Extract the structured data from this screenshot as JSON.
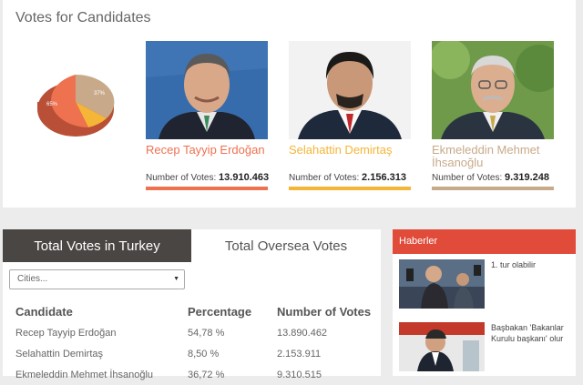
{
  "section_title": "Votes for Candidates",
  "pie": {
    "labels": [
      "65%",
      "37%"
    ],
    "colors": [
      "#ee7150",
      "#f5b536",
      "#c8aa8a"
    ]
  },
  "candidates": [
    {
      "name": "Recep Tayyip Erdoğan",
      "votes_label": "Number of Votes:",
      "votes": "13.910.463",
      "color": "#ee7150"
    },
    {
      "name": "Selahattin Demirtaş",
      "votes_label": "Number of Votes:",
      "votes": "2.156.313",
      "color": "#f5b536"
    },
    {
      "name": "Ekmeleddin Mehmet İhsanoğlu",
      "votes_label": "Number of Votes:",
      "votes": "9.319.248",
      "color": "#c8aa8a"
    }
  ],
  "tabs": {
    "turkey": "Total Votes in Turkey",
    "oversea": "Total Oversea Votes"
  },
  "cities_select": {
    "value": "Cities..."
  },
  "table": {
    "headers": [
      "Candidate",
      "Percentage",
      "Number of Votes"
    ],
    "rows": [
      [
        "Recep Tayyip Erdoğan",
        "54,78 %",
        "13.890.462"
      ],
      [
        "Selahattin Demirtaş",
        "8,50 %",
        "2.153.911"
      ],
      [
        "Ekmeleddin Mehmet İhsanoğlu",
        "36,72 %",
        "9.310.515"
      ]
    ]
  },
  "news": {
    "header": "Haberler",
    "items": [
      {
        "title": "1. tur olabilir"
      },
      {
        "title": "Başbakan 'Bakanlar Kurulu başkanı' olur"
      }
    ]
  }
}
